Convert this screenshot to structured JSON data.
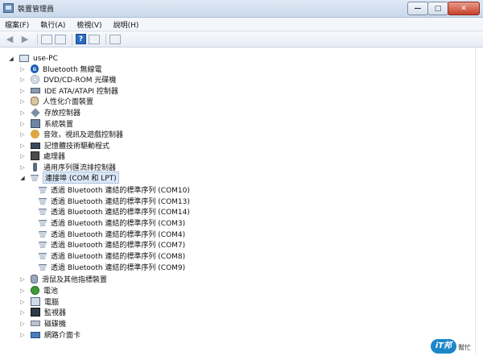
{
  "window": {
    "title": "裝置管理員",
    "buttons": {
      "minimize": "—",
      "maximize": "□",
      "close": "✕"
    }
  },
  "menu": [
    "檔案(F)",
    "執行(A)",
    "檢視(V)",
    "說明(H)"
  ],
  "toolbar": {
    "back_icon": "back-arrow-icon",
    "forward_icon": "forward-arrow-icon",
    "help_label": "?"
  },
  "tree": {
    "root": "use-PC",
    "categories_top": [
      {
        "label": "Bluetooth 無線電",
        "icon": "bluetooth-icon"
      },
      {
        "label": "DVD/CD-ROM 光碟機",
        "icon": "disc-icon"
      },
      {
        "label": "IDE ATA/ATAPI 控制器",
        "icon": "ide-icon"
      },
      {
        "label": "人性化介面裝置",
        "icon": "hid-icon"
      },
      {
        "label": "存放控制器",
        "icon": "storage-icon"
      },
      {
        "label": "系統裝置",
        "icon": "system-icon"
      },
      {
        "label": "音效，視訊及遊戲控制器",
        "icon": "sound-icon"
      },
      {
        "label": "記憶體技術驅動程式",
        "icon": "memory-icon"
      },
      {
        "label": "處理器",
        "icon": "cpu-icon"
      },
      {
        "label": "通用序列匯流排控制器",
        "icon": "usb-icon"
      }
    ],
    "ports": {
      "label": "連接埠 (COM 和 LPT)",
      "items": [
        "透過 Bluetooth 連結的標準序列 (COM10)",
        "透過 Bluetooth 連結的標準序列 (COM13)",
        "透過 Bluetooth 連結的標準序列 (COM14)",
        "透過 Bluetooth 連結的標準序列 (COM3)",
        "透過 Bluetooth 連結的標準序列 (COM4)",
        "透過 Bluetooth 連結的標準序列 (COM7)",
        "透過 Bluetooth 連結的標準序列 (COM8)",
        "透過 Bluetooth 連結的標準序列 (COM9)"
      ]
    },
    "categories_bottom": [
      {
        "label": "滑鼠及其他指標裝置",
        "icon": "mouse-icon"
      },
      {
        "label": "電池",
        "icon": "battery-icon"
      },
      {
        "label": "電腦",
        "icon": "computer-icon"
      },
      {
        "label": "監視器",
        "icon": "monitor-icon"
      },
      {
        "label": "磁碟機",
        "icon": "disk-icon"
      },
      {
        "label": "網路介面卡",
        "icon": "network-icon"
      }
    ]
  },
  "watermark": {
    "logo_text": "iT邦",
    "logo_sub": "幫忙"
  }
}
